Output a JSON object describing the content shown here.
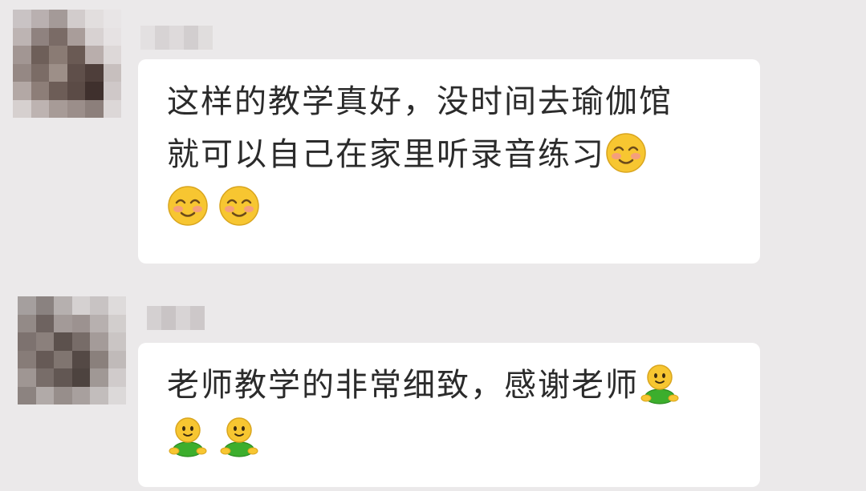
{
  "messages": [
    {
      "lines": [
        "这样的教学真好，没时间去瑜伽馆",
        "就可以自己在家里听录音练习",
        ""
      ],
      "emoji_name": "blush-smile-emoji"
    },
    {
      "lines": [
        "老师教学的非常细致，感谢老师",
        ""
      ],
      "emoji_name": "green-figure-emoji"
    }
  ],
  "colors": {
    "background": "#ebe9ea",
    "bubble": "#ffffff",
    "text": "#2b2b2b",
    "smile_yellow": "#f7c631",
    "figure_green": "#3cae2d"
  }
}
